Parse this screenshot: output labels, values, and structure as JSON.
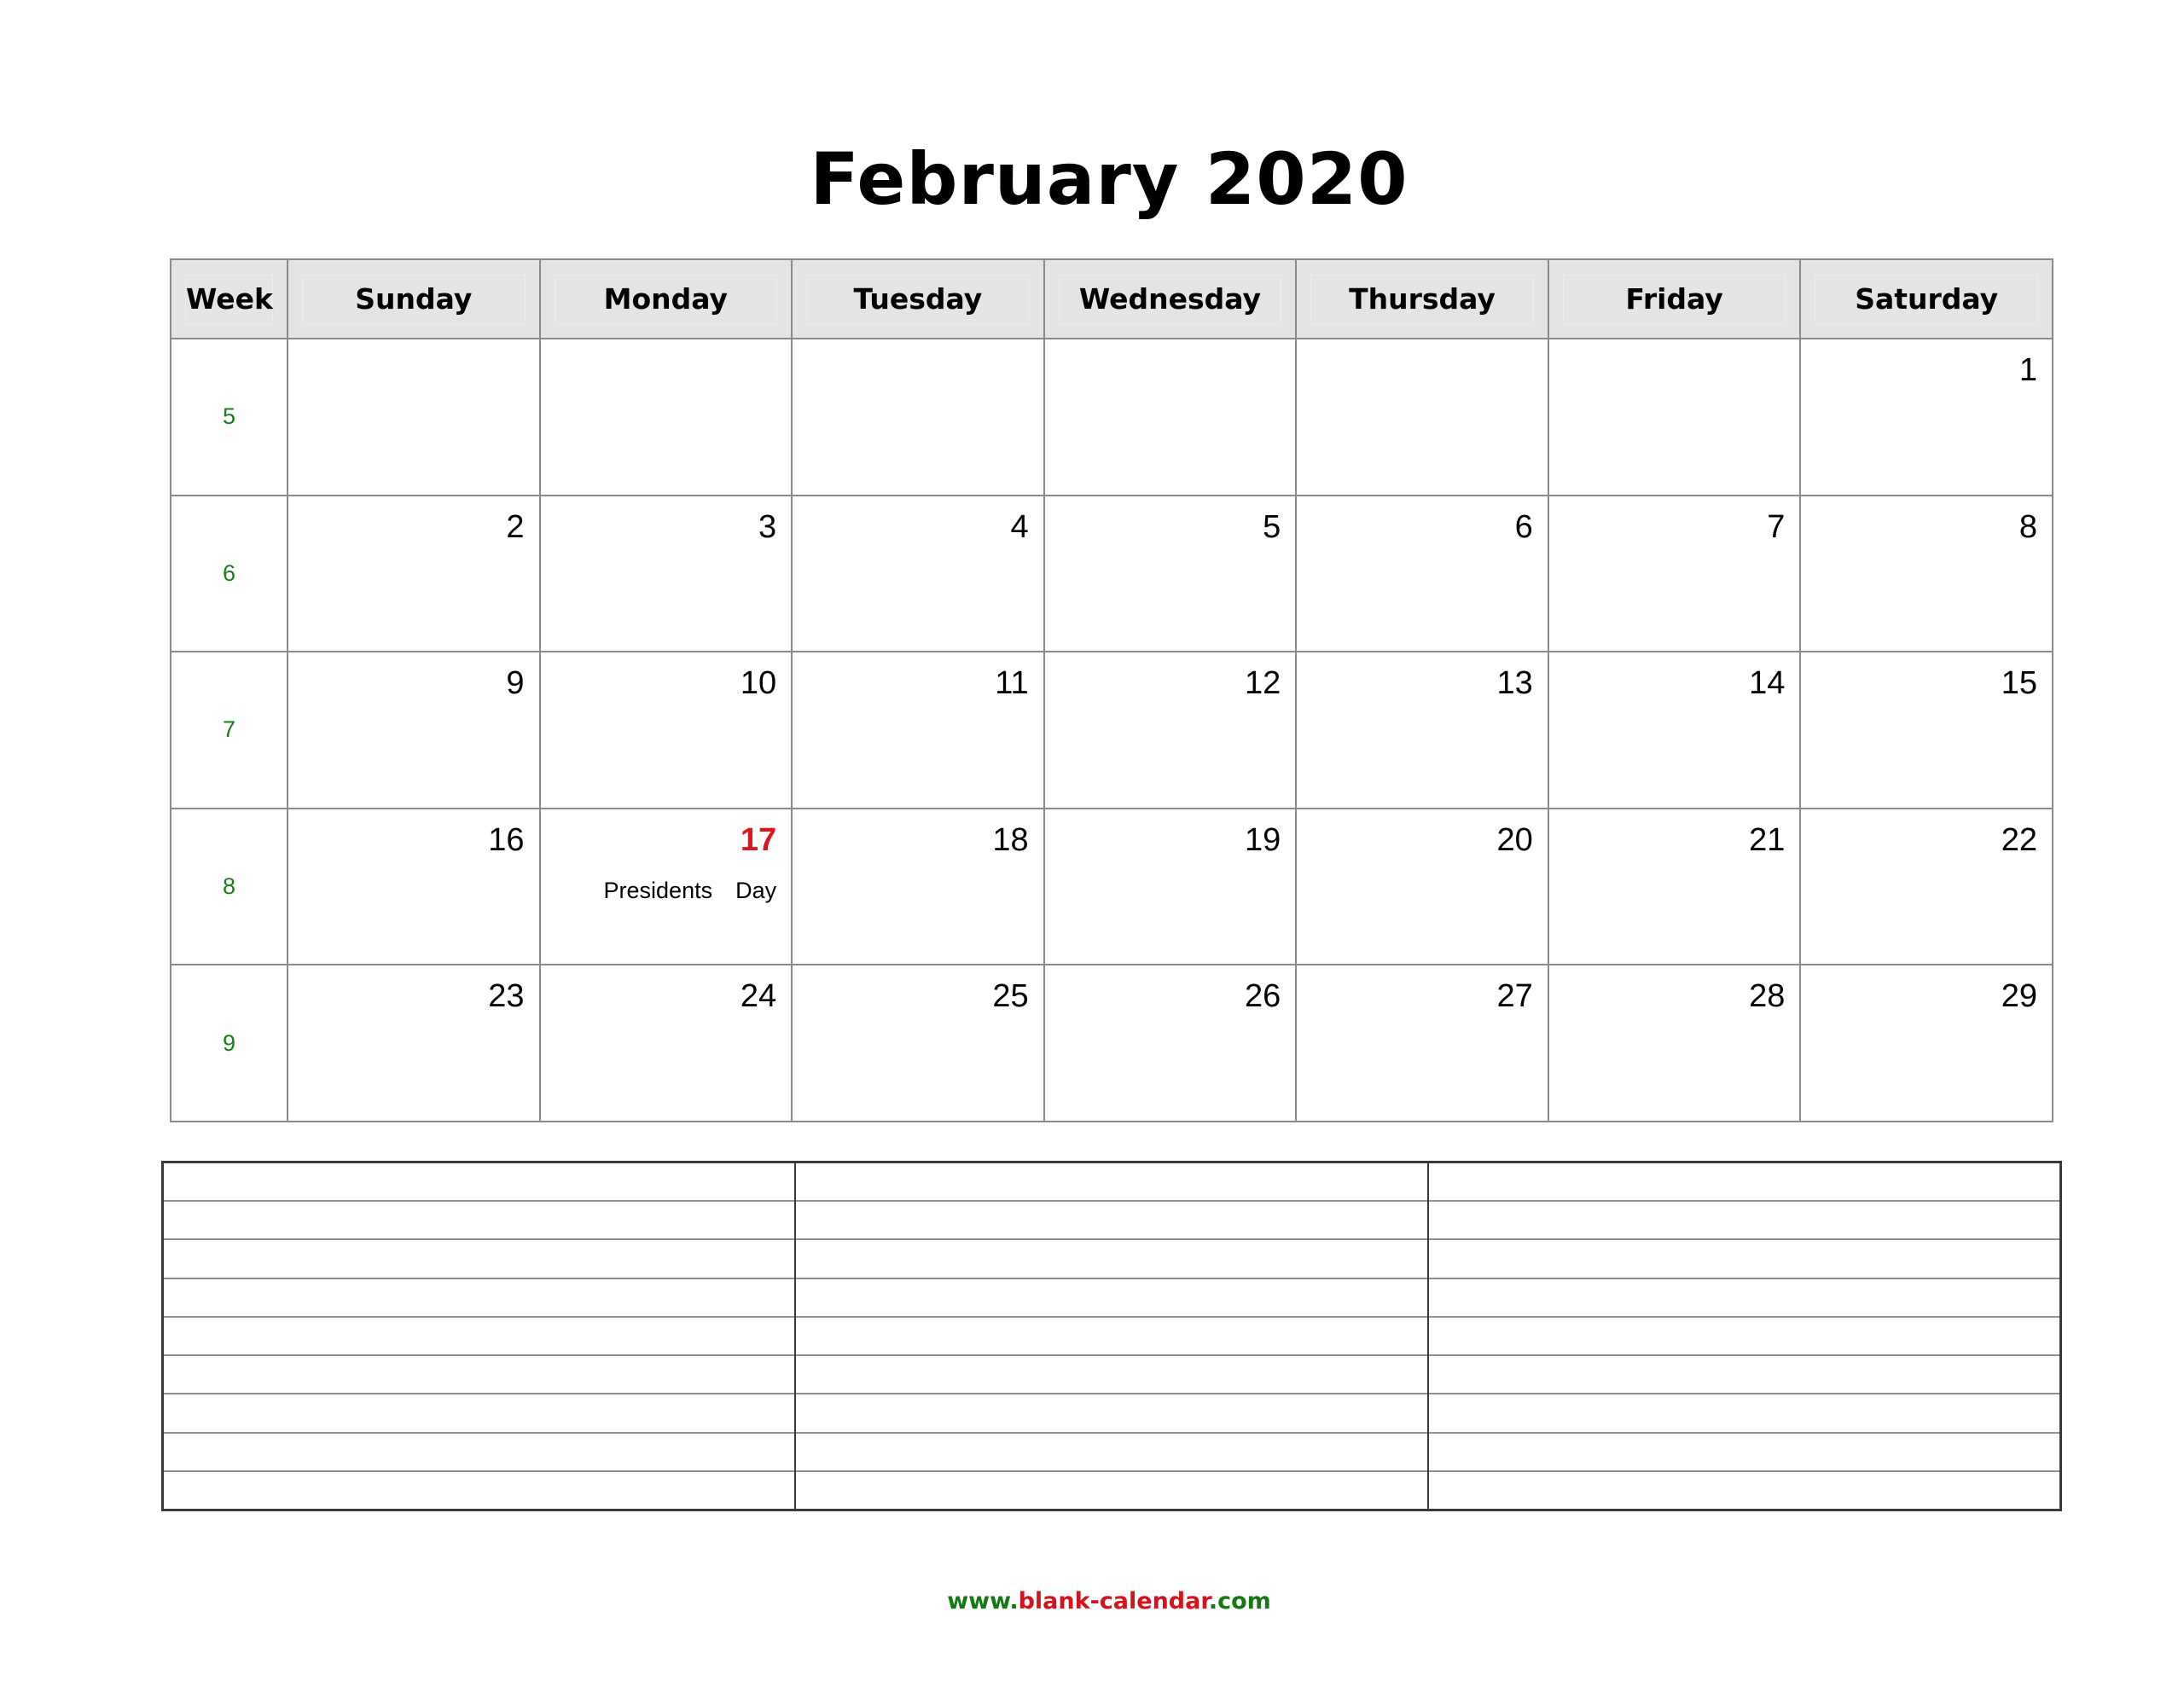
{
  "title": "February 2020",
  "header": {
    "week_label": "Week",
    "days": [
      "Sunday",
      "Monday",
      "Tuesday",
      "Wednesday",
      "Thursday",
      "Friday",
      "Saturday"
    ]
  },
  "weeks": [
    {
      "week": "5",
      "days": [
        "",
        "",
        "",
        "",
        "",
        "",
        "1"
      ]
    },
    {
      "week": "6",
      "days": [
        "2",
        "3",
        "4",
        "5",
        "6",
        "7",
        "8"
      ]
    },
    {
      "week": "7",
      "days": [
        "9",
        "10",
        "11",
        "12",
        "13",
        "14",
        "15"
      ]
    },
    {
      "week": "8",
      "days": [
        "16",
        "17",
        "18",
        "19",
        "20",
        "21",
        "22"
      ]
    },
    {
      "week": "9",
      "days": [
        "23",
        "24",
        "25",
        "26",
        "27",
        "28",
        "29"
      ]
    }
  ],
  "holidays": [
    {
      "date": "17",
      "name": "Presidents  Day",
      "color": "#e0141c"
    }
  ],
  "notes": {
    "columns": 3,
    "lines": 9
  },
  "footer": {
    "prefix": "www.",
    "name": "blank-calendar",
    "suffix": ".com",
    "prefix_color": "#137a13",
    "name_color": "#d4141c"
  }
}
